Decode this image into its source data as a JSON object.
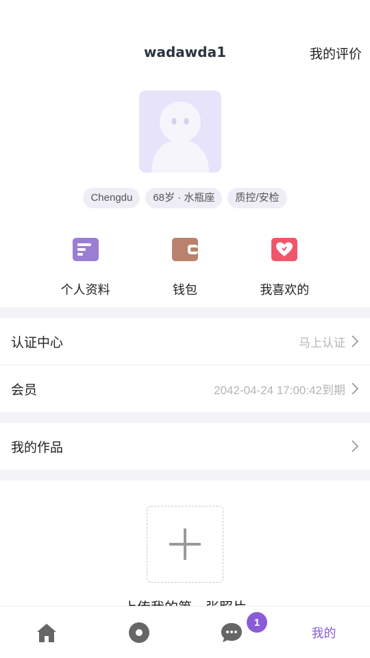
{
  "header": {
    "username": "wadawda1",
    "review_link": "我的评价"
  },
  "profile": {
    "tags": [
      "Chengdu",
      "68岁 · 水瓶座",
      "质控/安检"
    ]
  },
  "actions": [
    {
      "label": "个人资料",
      "icon": "profile-card-icon"
    },
    {
      "label": "钱包",
      "icon": "wallet-icon"
    },
    {
      "label": "我喜欢的",
      "icon": "heart-icon"
    }
  ],
  "menu": {
    "certification": {
      "title": "认证中心",
      "action": "马上认证"
    },
    "membership": {
      "title": "会员",
      "expiry": "2042-04-24 17:00:42到期"
    },
    "works": {
      "title": "我的作品"
    }
  },
  "upload": {
    "text": "上传我的第一张照片"
  },
  "tabbar": {
    "items": [
      {
        "name": "home",
        "icon": "home-icon"
      },
      {
        "name": "discover",
        "icon": "record-icon"
      },
      {
        "name": "messages",
        "icon": "chat-icon",
        "badge": "1"
      },
      {
        "name": "mine",
        "label": "我的"
      }
    ]
  },
  "colors": {
    "accent": "#8a5bd6",
    "section_gap": "#f4f4f8",
    "tag_bg": "#efedf5"
  }
}
